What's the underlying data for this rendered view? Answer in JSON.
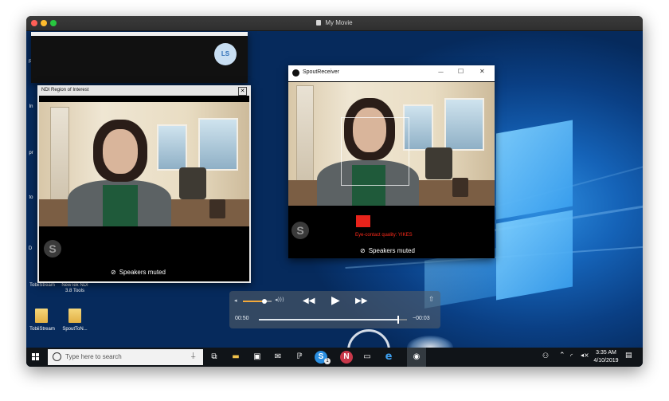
{
  "app": {
    "title": "My Movie"
  },
  "desktop": {
    "icons": [
      {
        "label": "TobiiStream"
      },
      {
        "label": "NewTek NDI 3.8 Tools"
      },
      {
        "label": "TobiiStream"
      },
      {
        "label": "SpoutToN..."
      }
    ],
    "side_letters": [
      "R",
      "In",
      "pr",
      "to",
      "D"
    ]
  },
  "skype_window": {
    "avatar_initials": "LS"
  },
  "ndi_window": {
    "title": "NDI Region of Interest",
    "close_label": "✕",
    "speakers_status": "Speakers muted",
    "skype_logo": "S"
  },
  "spout_window": {
    "title": "SpoutReceiver",
    "minimize_label": "—",
    "maximize_label": "☐",
    "close_label": "✕",
    "quality_label": "Eye-contact quality:  YIKES",
    "quality_color": "#ff2a1a",
    "speakers_status": "Speakers muted",
    "skype_logo": "S"
  },
  "player": {
    "elapsed": "00:50",
    "remaining": "−00:03",
    "volume_fraction": 0.75,
    "progress_fraction": 0.94
  },
  "taskbar": {
    "search_placeholder": "Type here to search",
    "skype_badge": "1",
    "clock_time": "3:35 AM",
    "clock_date": "4/10/2019"
  }
}
